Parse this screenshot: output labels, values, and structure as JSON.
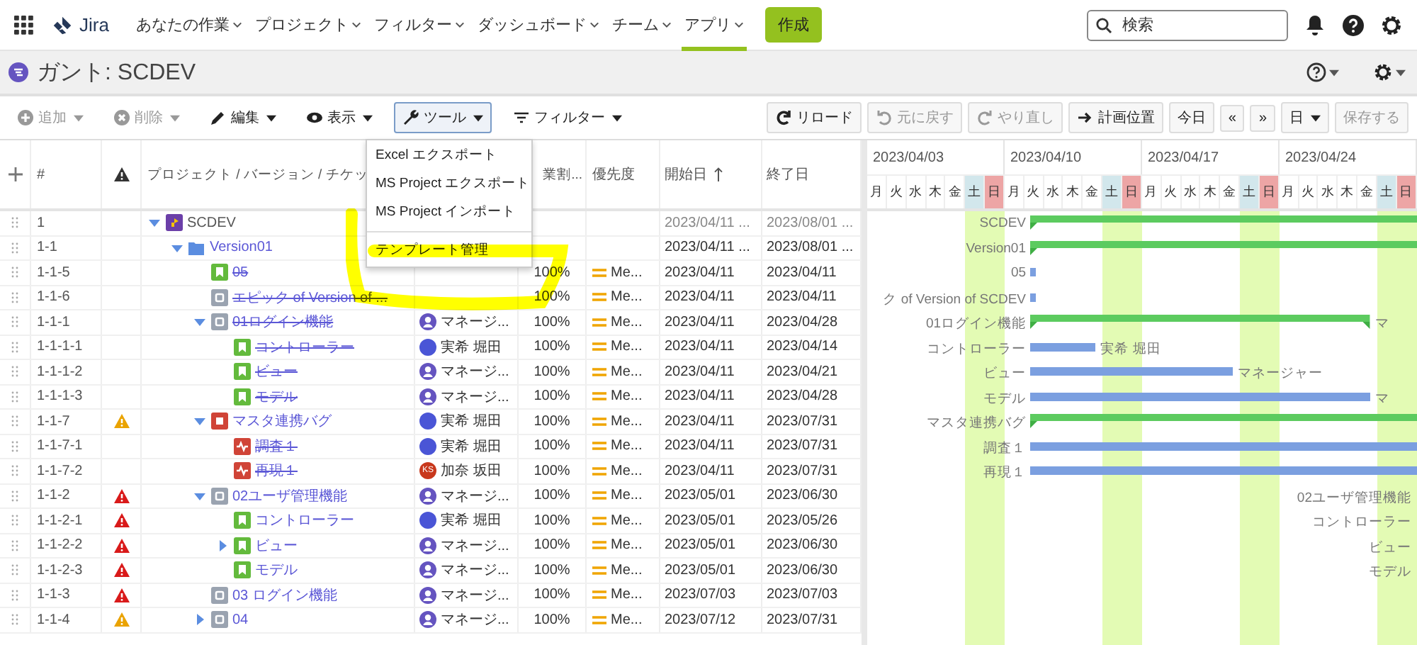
{
  "nav": {
    "logo": "Jira",
    "items": [
      {
        "label": "あなたの作業",
        "selected": false
      },
      {
        "label": "プロジェクト",
        "selected": false
      },
      {
        "label": "フィルター",
        "selected": false
      },
      {
        "label": "ダッシュボード",
        "selected": false
      },
      {
        "label": "チーム",
        "selected": false
      },
      {
        "label": "アプリ",
        "selected": true
      }
    ],
    "create": "作成",
    "search": {
      "placeholder": "検索"
    }
  },
  "page_header": {
    "title": "ガント: SCDEV"
  },
  "toolbar": {
    "left": [
      {
        "label": "追加",
        "kind": "add",
        "disabled": true,
        "open": false
      },
      {
        "label": "削除",
        "kind": "delete",
        "disabled": true,
        "open": false
      },
      {
        "label": "編集",
        "kind": "edit",
        "disabled": false,
        "open": false
      },
      {
        "label": "表示",
        "kind": "view",
        "disabled": false,
        "open": false
      },
      {
        "label": "ツール",
        "kind": "tools",
        "disabled": false,
        "open": true
      },
      {
        "label": "フィルター",
        "kind": "filter",
        "disabled": false,
        "open": false
      }
    ],
    "right": [
      {
        "label": "リロード",
        "kind": "reload",
        "disabled": false,
        "caret": false
      },
      {
        "label": "元に戻す",
        "kind": "undo",
        "disabled": true,
        "caret": false
      },
      {
        "label": "やり直し",
        "kind": "redo",
        "disabled": true,
        "caret": false
      },
      {
        "label": "計画位置",
        "kind": "jump",
        "disabled": false,
        "caret": false
      },
      {
        "label": "今日",
        "kind": "text",
        "disabled": false,
        "caret": false
      },
      {
        "label": "«",
        "kind": "text",
        "disabled": false,
        "caret": false
      },
      {
        "label": "»",
        "kind": "text",
        "disabled": false,
        "caret": false
      },
      {
        "label": "日",
        "kind": "text",
        "disabled": false,
        "caret": true
      },
      {
        "label": "保存する",
        "kind": "text",
        "disabled": true,
        "caret": false
      }
    ]
  },
  "menu": {
    "items": [
      {
        "kind": "item",
        "label": "Excel エクスポート"
      },
      {
        "kind": "item",
        "label": "MS Project エクスポート"
      },
      {
        "kind": "item",
        "label": "MS Project インポート"
      },
      {
        "kind": "separator"
      },
      {
        "kind": "item",
        "label": "テンプレート管理"
      }
    ]
  },
  "table": {
    "columns": {
      "number": "#",
      "project": "プロジェクト / バージョン / チケッ",
      "progress": "業割...",
      "priority": "優先度",
      "start": "開始日",
      "end": "終了日"
    },
    "rows": [
      {
        "num": "1",
        "kind": "project",
        "name": "SCDEV",
        "done": false,
        "expanded": true,
        "start": "2023/04/11 ...",
        "end": "2023/08/01 ...",
        "gantt_label": "SCDEV",
        "children": [
          {
            "num": "1-1",
            "kind": "version",
            "name": "Version01",
            "done": false,
            "expanded": true,
            "start": "2023/04/11 ...",
            "end": "2023/08/01 ...",
            "gantt_label": "Version01",
            "children": [
              {
                "num": "1-1-5",
                "kind": "story",
                "name": "05",
                "done": true,
                "progress": "100%",
                "priority": "Me...",
                "start": "2023/04/11",
                "end": "2023/04/11",
                "gantt_label": "05"
              },
              {
                "num": "1-1-6",
                "kind": "epic",
                "name": "エピック of Version of ...",
                "done": true,
                "progress": "100%",
                "priority": "Me...",
                "start": "2023/04/11",
                "end": "2023/04/11",
                "gantt_label": "ク of Version of SCDEV"
              },
              {
                "num": "1-1-1",
                "kind": "epic",
                "name": "01ログイン機能",
                "done": true,
                "expanded": true,
                "assignee": {
                  "name": "マネージ...",
                  "kind": "silhouette"
                },
                "progress": "100%",
                "priority": "Me...",
                "start": "2023/04/11",
                "end": "2023/04/28",
                "gantt_label": "01ログイン機能",
                "gantt_assignee": "マ",
                "children": [
                  {
                    "num": "1-1-1-1",
                    "kind": "story",
                    "name": "コントローラー",
                    "done": true,
                    "assignee": {
                      "name": "実希 堀田",
                      "kind": "dot",
                      "color": "#4a55d6"
                    },
                    "progress": "100%",
                    "priority": "Me...",
                    "start": "2023/04/11",
                    "end": "2023/04/14",
                    "gantt_label": "コントローラー",
                    "gantt_assignee": "実希 堀田"
                  },
                  {
                    "num": "1-1-1-2",
                    "kind": "story",
                    "name": "ビュー",
                    "done": true,
                    "assignee": {
                      "name": "マネージ...",
                      "kind": "silhouette"
                    },
                    "progress": "100%",
                    "priority": "Me...",
                    "start": "2023/04/11",
                    "end": "2023/04/21",
                    "gantt_label": "ビュー",
                    "gantt_assignee": "マネージャー"
                  },
                  {
                    "num": "1-1-1-3",
                    "kind": "story",
                    "name": "モデル",
                    "done": true,
                    "assignee": {
                      "name": "マネージ...",
                      "kind": "silhouette"
                    },
                    "progress": "100%",
                    "priority": "Me...",
                    "start": "2023/04/11",
                    "end": "2023/04/28",
                    "gantt_label": "モデル",
                    "gantt_assignee": "マ"
                  }
                ]
              },
              {
                "num": "1-1-7",
                "warning": {
                  "color": "#eaa300"
                },
                "kind": "bug",
                "name": "マスタ連携バグ",
                "done": false,
                "expanded": true,
                "assignee": {
                  "name": "実希 堀田",
                  "kind": "dot",
                  "color": "#4a55d6"
                },
                "progress": "100%",
                "priority": "Me...",
                "start": "2023/04/11",
                "end": "2023/07/31",
                "gantt_label": "マスタ連携バグ",
                "children": [
                  {
                    "num": "1-1-7-1",
                    "kind": "subbug",
                    "name": "調査１",
                    "done": true,
                    "assignee": {
                      "name": "実希 堀田",
                      "kind": "dot",
                      "color": "#4a55d6"
                    },
                    "progress": "100%",
                    "priority": "Me...",
                    "start": "2023/04/11",
                    "end": "2023/07/31",
                    "gantt_label": "調査１"
                  },
                  {
                    "num": "1-1-7-2",
                    "kind": "subbug",
                    "name": "再現１",
                    "done": true,
                    "assignee": {
                      "name": "加奈 坂田",
                      "kind": "initials",
                      "initials": "KS",
                      "color": "#c8381c"
                    },
                    "progress": "100%",
                    "priority": "Me...",
                    "start": "2023/04/11",
                    "end": "2023/07/31",
                    "gantt_label": "再現１"
                  }
                ]
              },
              {
                "num": "1-1-2",
                "warning": {
                  "color": "#d91a1a"
                },
                "kind": "epic",
                "name": "02ユーザ管理機能",
                "done": false,
                "expanded": true,
                "assignee": {
                  "name": "マネージ...",
                  "kind": "silhouette"
                },
                "progress": "100%",
                "priority": "Me...",
                "start": "2023/05/01",
                "end": "2023/06/30",
                "gantt_label": "02ユーザ管理機能",
                "children": [
                  {
                    "num": "1-1-2-1",
                    "warning": {
                      "color": "#d91a1a"
                    },
                    "kind": "story",
                    "name": "コントローラー",
                    "done": false,
                    "assignee": {
                      "name": "実希 堀田",
                      "kind": "dot",
                      "color": "#4a55d6"
                    },
                    "progress": "100%",
                    "priority": "Me...",
                    "start": "2023/05/01",
                    "end": "2023/05/26",
                    "gantt_label": "コントローラー"
                  },
                  {
                    "num": "1-1-2-2",
                    "warning": {
                      "color": "#d91a1a"
                    },
                    "kind": "story",
                    "name": "ビュー",
                    "done": false,
                    "expanded": false,
                    "assignee": {
                      "name": "マネージ...",
                      "kind": "silhouette"
                    },
                    "progress": "100%",
                    "priority": "Me...",
                    "start": "2023/05/01",
                    "end": "2023/06/30",
                    "gantt_label": "ビュー"
                  },
                  {
                    "num": "1-1-2-3",
                    "warning": {
                      "color": "#d91a1a"
                    },
                    "kind": "story",
                    "name": "モデル",
                    "done": false,
                    "assignee": {
                      "name": "マネージ...",
                      "kind": "silhouette"
                    },
                    "progress": "100%",
                    "priority": "Me...",
                    "start": "2023/05/01",
                    "end": "2023/06/30",
                    "gantt_label": "モデル"
                  }
                ]
              },
              {
                "num": "1-1-3",
                "warning": {
                  "color": "#d91a1a"
                },
                "kind": "epic",
                "name": "03 ログイン機能",
                "done": false,
                "assignee": {
                  "name": "マネージ...",
                  "kind": "silhouette"
                },
                "progress": "100%",
                "priority": "Me...",
                "start": "2023/07/03",
                "end": "2023/07/03"
              },
              {
                "num": "1-1-4",
                "warning": {
                  "color": "#eaa300"
                },
                "kind": "epic",
                "name": "04",
                "done": false,
                "expanded": false,
                "assignee": {
                  "name": "マネージ...",
                  "kind": "silhouette"
                },
                "progress": "100%",
                "priority": "Me...",
                "start": "2023/07/12",
                "end": "2023/07/31"
              }
            ]
          }
        ]
      }
    ]
  },
  "gantt": {
    "weeks": [
      {
        "label": "2023/04/03",
        "days": [
          {
            "label": "月",
            "kind": "weekday"
          },
          {
            "label": "火",
            "kind": "weekday"
          },
          {
            "label": "水",
            "kind": "weekday"
          },
          {
            "label": "木",
            "kind": "weekday"
          },
          {
            "label": "金",
            "kind": "weekday"
          },
          {
            "label": "土",
            "kind": "saturday"
          },
          {
            "label": "日",
            "kind": "sunday"
          }
        ]
      },
      {
        "label": "2023/04/10",
        "days": [
          {
            "label": "月",
            "kind": "weekday"
          },
          {
            "label": "火",
            "kind": "weekday"
          },
          {
            "label": "水",
            "kind": "weekday"
          },
          {
            "label": "木",
            "kind": "weekday"
          },
          {
            "label": "金",
            "kind": "weekday"
          },
          {
            "label": "土",
            "kind": "saturday"
          },
          {
            "label": "日",
            "kind": "sunday"
          }
        ]
      },
      {
        "label": "2023/04/17",
        "days": [
          {
            "label": "月",
            "kind": "weekday"
          },
          {
            "label": "火",
            "kind": "weekday"
          },
          {
            "label": "水",
            "kind": "weekday"
          },
          {
            "label": "木",
            "kind": "weekday"
          },
          {
            "label": "金",
            "kind": "weekday"
          },
          {
            "label": "土",
            "kind": "saturday"
          },
          {
            "label": "日",
            "kind": "sunday"
          }
        ]
      },
      {
        "label": "2023/04/24",
        "days": [
          {
            "label": "月",
            "kind": "weekday"
          },
          {
            "label": "火",
            "kind": "weekday"
          },
          {
            "label": "水",
            "kind": "weekday"
          },
          {
            "label": "木",
            "kind": "weekday"
          },
          {
            "label": "金",
            "kind": "weekday"
          },
          {
            "label": "土",
            "kind": "saturday"
          },
          {
            "label": "日",
            "kind": "sunday"
          }
        ]
      }
    ]
  }
}
